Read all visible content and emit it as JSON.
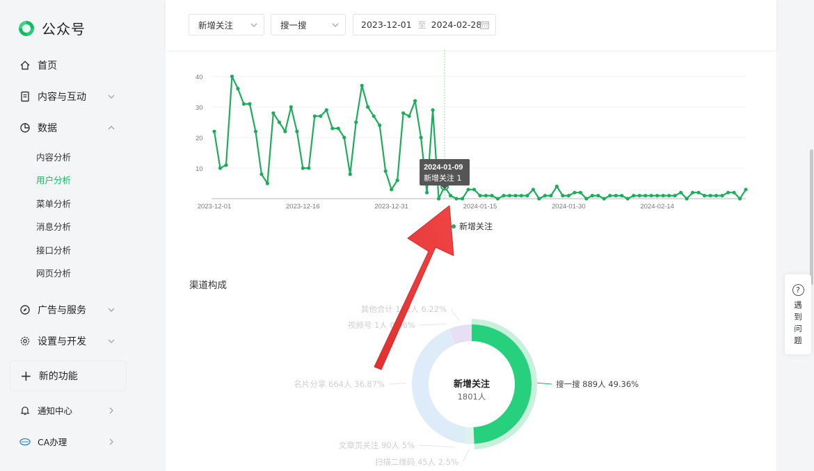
{
  "app": {
    "title": "公众号"
  },
  "sidebar": {
    "items": [
      {
        "label": "首页"
      },
      {
        "label": "内容与互动"
      },
      {
        "label": "数据"
      }
    ],
    "sub_items": [
      {
        "label": "内容分析"
      },
      {
        "label": "用户分析"
      },
      {
        "label": "菜单分析"
      },
      {
        "label": "消息分析"
      },
      {
        "label": "接口分析"
      },
      {
        "label": "网页分析"
      }
    ],
    "lower_items": [
      {
        "label": "广告与服务"
      },
      {
        "label": "设置与开发"
      }
    ],
    "new_feature": "新的功能",
    "notify": "通知中心",
    "ca": "CA办理"
  },
  "filters": {
    "metric": "新增关注",
    "source": "搜一搜",
    "date_start": "2023-12-01",
    "date_sep": "至",
    "date_end": "2024-02-28"
  },
  "tooltip": {
    "date": "2024-01-09",
    "text": "新增关注 1"
  },
  "help": {
    "label": "遇到问题"
  },
  "section": {
    "channel_title": "渠道构成"
  },
  "colors": {
    "accent": "#07c160",
    "line": "#1aad5a",
    "arrow": "#e53535"
  },
  "chart_data": [
    {
      "type": "line",
      "title": "",
      "xlabel": "",
      "ylabel": "",
      "ylim": [
        0,
        40
      ],
      "y_ticks": [
        "10",
        "20",
        "30",
        "40"
      ],
      "x_tick_labels": [
        "2023-12-01",
        "2023-12-16",
        "2023-12-31",
        "2024-01-15",
        "2024-01-30",
        "2024-02-14"
      ],
      "x_start": "2023-12-01",
      "x_end": "2024-02-28",
      "grid": true,
      "legend": "bottom-center",
      "series": [
        {
          "name": "新增关注",
          "values": [
            22,
            10,
            11,
            40,
            36,
            31,
            31,
            22,
            8,
            5,
            28,
            25,
            22,
            30,
            22,
            10,
            10,
            27,
            27,
            29,
            23,
            23,
            20,
            8,
            25,
            37,
            30,
            27,
            24,
            9,
            3,
            6,
            28,
            27,
            32,
            20,
            2,
            29,
            0,
            4,
            1,
            0,
            0,
            3,
            3,
            1,
            1,
            1,
            0,
            1,
            1,
            1,
            1,
            1,
            3,
            0,
            1,
            1,
            4,
            1,
            1,
            2,
            2,
            0,
            1,
            1,
            0,
            1,
            1,
            1,
            0,
            1,
            1,
            1,
            1,
            1,
            1,
            1,
            1,
            2,
            0,
            2,
            2,
            1,
            1,
            1,
            1,
            2,
            2,
            0,
            3
          ]
        }
      ]
    },
    {
      "type": "pie",
      "title": "渠道构成",
      "center_label": "新增关注",
      "center_value": "1801人",
      "slices": [
        {
          "label": "搜一搜 889人 49.36%",
          "value": 49.36,
          "color": "#26d07c"
        },
        {
          "label": "扫描二维码 45人 2.5%",
          "value": 2.5,
          "color": "#ddf3ec"
        },
        {
          "label": "文章页关注 90人 5%",
          "value": 5,
          "color": "#dbeef6"
        },
        {
          "label": "名片分享 664人 36.87%",
          "value": 36.87,
          "color": "#deecf9"
        },
        {
          "label": "视频号 1人 0.06%",
          "value": 0.06,
          "color": "#eeeef5"
        },
        {
          "label": "其他合计 112人 6.22%",
          "value": 6.22,
          "color": "#e7e0f4"
        }
      ]
    }
  ]
}
